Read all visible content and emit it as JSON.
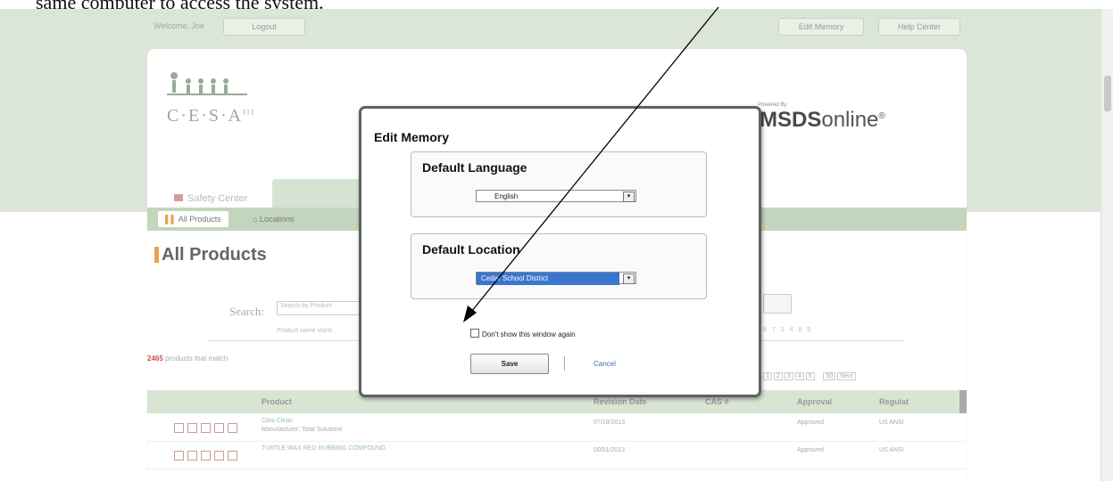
{
  "doc": {
    "text": "same computer to access the system."
  },
  "topbar": {
    "welcome": "Welcome, Joe",
    "logout": "Logout",
    "edit_memory": "Edit Memory",
    "help_center": "Help Center"
  },
  "logo": {
    "text": "C·E·S·A",
    "sup": "III"
  },
  "msds": {
    "powered": "Powered By",
    "brand_bold": "MSDS",
    "brand_rest": "online",
    "reg": "®"
  },
  "tabs": {
    "safety_center": "Safety Center"
  },
  "subnav": {
    "all_products": "All Products",
    "locations": "Locations"
  },
  "page": {
    "title": "All Products",
    "search_label": "Search:",
    "search_placeholder": "Search by Product",
    "product_name_hint": "Product name starts",
    "alpha": "8 7 2 4 8 9",
    "count_number": "2465",
    "count_text": " products that match",
    "pager": [
      "1",
      "2",
      "3",
      "4",
      "5",
      "50",
      "Next"
    ]
  },
  "table": {
    "headers": [
      "Product",
      "Revision Date",
      "CAS #",
      "Approval",
      "Regulat"
    ],
    "rows": [
      {
        "product": "Citra Clean",
        "manufacturer": "Manufacturer: Total Solutions",
        "date": "07/10/2013",
        "approval": "Approved",
        "reg": "US ANSI"
      },
      {
        "product": "TURTLE WAX RED RUBBING COMPOUND",
        "manufacturer": "",
        "date": "00/01/2013",
        "approval": "Approved",
        "reg": "US ANSI"
      }
    ]
  },
  "modal": {
    "title": "Edit Memory",
    "default_language": {
      "legend": "Default Language",
      "value": "English"
    },
    "default_location": {
      "legend": "Default Location",
      "value": "Cedar School District"
    },
    "dont_show": "Don't show this window again",
    "save": "Save",
    "cancel": "Cancel"
  },
  "colors": {
    "band": "#dbe6d8",
    "modal_border": "#606060",
    "select_highlight": "#3a75d0"
  }
}
